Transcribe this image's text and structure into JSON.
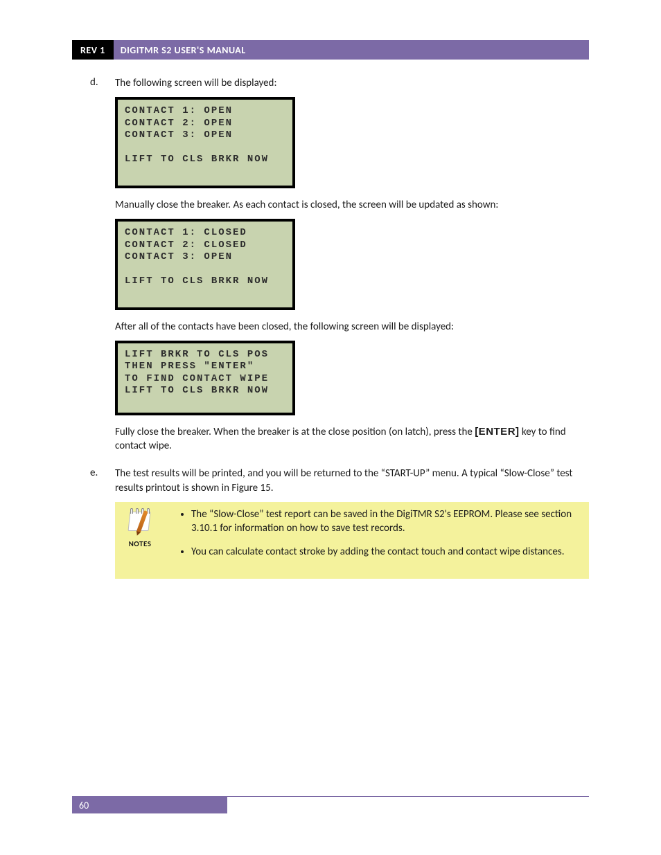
{
  "header": {
    "rev": "REV 1",
    "title": "DIGITMR S2 USER'S MANUAL"
  },
  "items": {
    "d": {
      "marker": "d.",
      "intro": "The following screen will be displayed:",
      "lcd1": "CONTACT 1: OPEN\nCONTACT 2: OPEN\nCONTACT 3: OPEN\n\nLIFT TO CLS BRKR NOW",
      "para1": "Manually close the breaker. As each contact is closed, the screen will be updated as shown:",
      "lcd2": "CONTACT 1: CLOSED\nCONTACT 2: CLOSED\nCONTACT 3: OPEN\n\nLIFT TO CLS BRKR NOW",
      "para2": "After all of the contacts have been closed, the following screen will be displayed:",
      "lcd3": "LIFT BRKR TO CLS POS\nTHEN PRESS \"ENTER\"\nTO FIND CONTACT WIPE\nLIFT TO CLS BRKR NOW",
      "para3_a": "Fully close the breaker. When the breaker is at the close position (on latch), press the ",
      "para3_key": "[ENTER]",
      "para3_b": " key to find contact wipe."
    },
    "e": {
      "marker": "e.",
      "text": "The test results will be printed, and you will be returned to the “START-UP” menu. A typical “Slow-Close” test results printout is shown in Figure 15."
    }
  },
  "notes": {
    "label": "NOTES",
    "bullets": [
      "The “Slow-Close” test report can be saved in the DigiTMR S2's EEPROM. Please see section 3.10.1 for information on how to save test records.",
      "You can calculate contact stroke by adding the contact touch and contact wipe distances."
    ]
  },
  "footer": {
    "page": "60"
  }
}
